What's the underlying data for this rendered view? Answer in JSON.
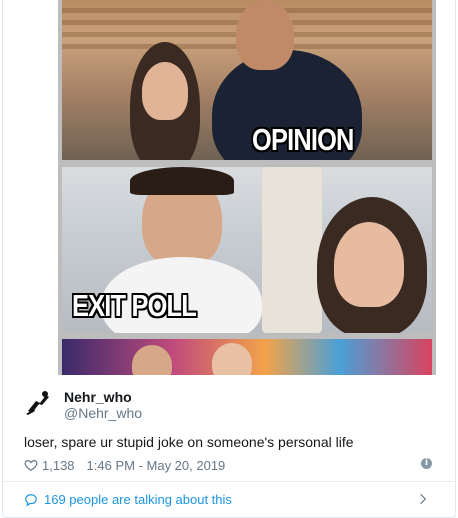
{
  "meme": {
    "caption_top": "OPINION POLL",
    "caption_bottom": "EXIT POLL"
  },
  "reply": {
    "author_name": "Nehr_who",
    "author_handle": "@Nehr_who",
    "text": "loser, spare ur stupid joke on someone's personal life",
    "likes": "1,138",
    "timestamp": "1:46 PM - May 20, 2019"
  },
  "conversation": {
    "label": "169 people are talking about this"
  },
  "icons": {
    "like": "heart-icon",
    "info": "info-icon",
    "reply": "speech-bubble-icon",
    "chevron": "chevron-right-icon"
  },
  "colors": {
    "link": "#1b95e0",
    "secondary_text": "#657786",
    "primary_text": "#14171a"
  }
}
